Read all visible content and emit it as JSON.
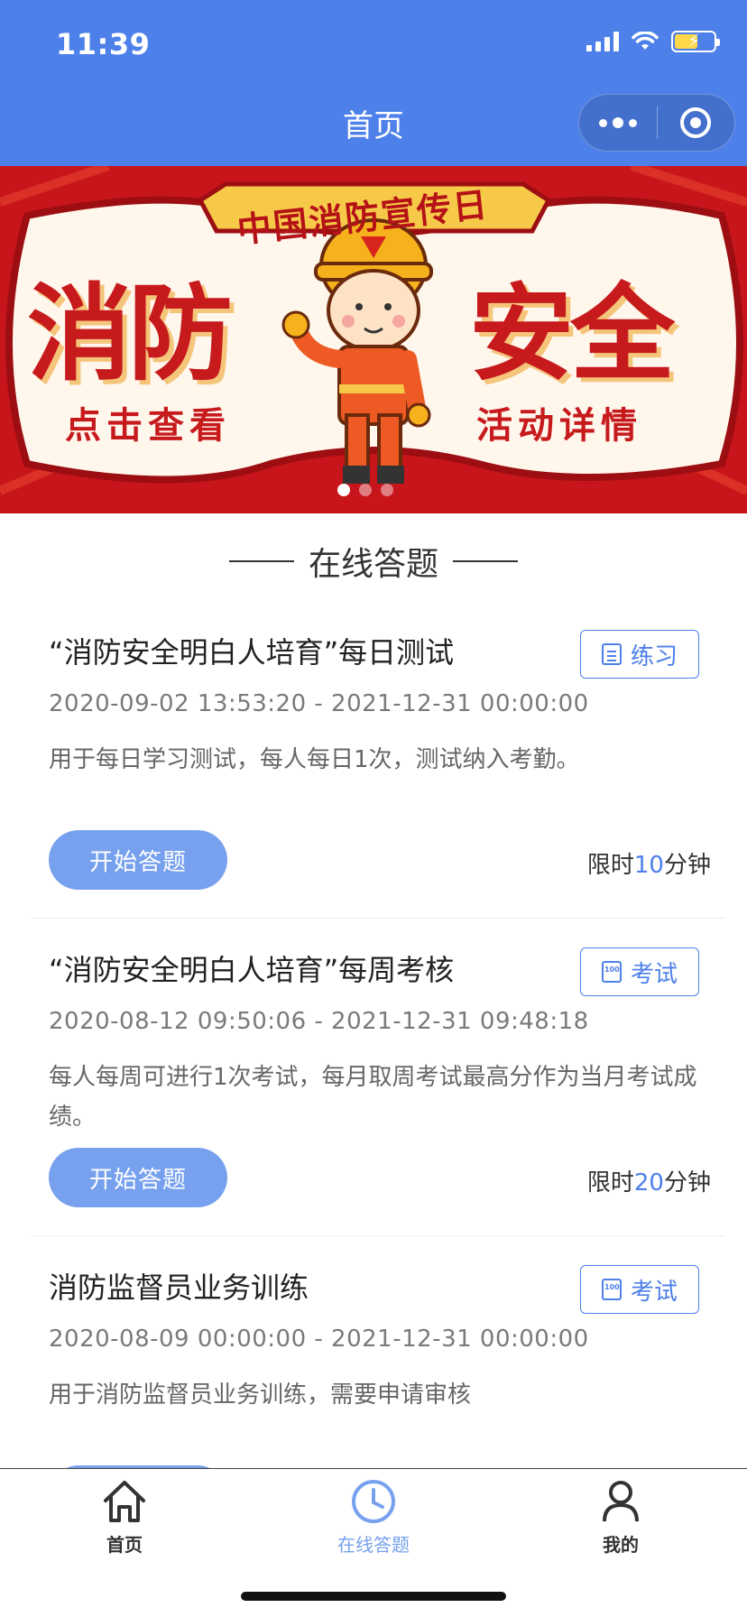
{
  "status_bar": {
    "time": "11:39"
  },
  "nav": {
    "title": "首页",
    "more_icon": "more-dots-icon",
    "close_icon": "target-icon"
  },
  "banner": {
    "ribbon": "中国消防宣传日",
    "left_big": "消防",
    "right_big": "安全",
    "left_small": "点击查看",
    "right_small": "活动详情",
    "carousel_dots": 3,
    "active_dot": 1,
    "colors": {
      "background": "#c8151b",
      "cloud": "#ffffff",
      "text": "#c71a1d",
      "ribbon": "#f7c948"
    }
  },
  "section": {
    "title": "在线答题"
  },
  "quizzes": [
    {
      "title": "“消防安全明白人培育”每日测试",
      "time_range": "2020-09-02 13:53:20 - 2021-12-31 00:00:00",
      "description": "用于每日学习测试，每人每日1次，测试纳入考勤。",
      "tag": "练习",
      "tag_icon": "list-icon",
      "button": "开始答题",
      "limit_prefix": "限时",
      "limit_value": "10",
      "limit_suffix": "分钟"
    },
    {
      "title": "“消防安全明白人培育”每周考核",
      "time_range": "2020-08-12 09:50:06 - 2021-12-31 09:48:18",
      "description": "每人每周可进行1次考试，每月取周考试最高分作为当月考试成绩。",
      "tag": "考试",
      "tag_icon": "exam-paper-icon",
      "button": "开始答题",
      "limit_prefix": "限时",
      "limit_value": "20",
      "limit_suffix": "分钟"
    },
    {
      "title": "消防监督员业务训练",
      "time_range": "2020-08-09 00:00:00 - 2021-12-31 00:00:00",
      "description": "用于消防监督员业务训练，需要申请审核",
      "tag": "考试",
      "tag_icon": "exam-paper-icon"
    }
  ],
  "tabbar": {
    "items": [
      {
        "label": "首页",
        "icon": "home-icon",
        "active": false
      },
      {
        "label": "在线答题",
        "icon": "clock-icon",
        "active": true
      },
      {
        "label": "我的",
        "icon": "user-icon",
        "active": false
      }
    ],
    "accent": "#77a1ee"
  },
  "colors": {
    "primary": "#4e80ea",
    "button": "#77a1ee"
  }
}
